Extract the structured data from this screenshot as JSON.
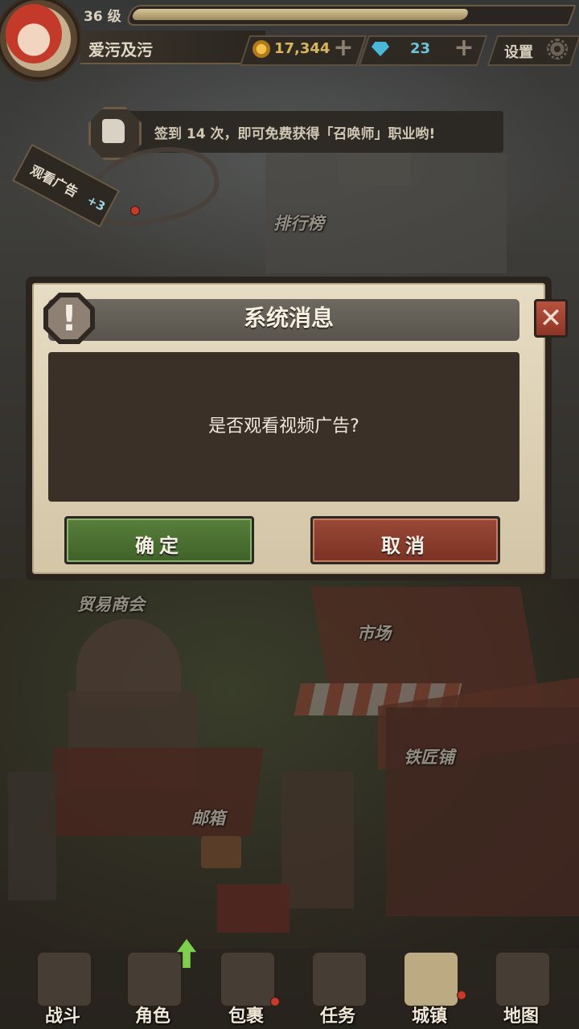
{
  "player": {
    "level": "36 级",
    "name": "爱污及污",
    "xp_progress": 0.77
  },
  "currency": {
    "coins": "17,344",
    "gems": "23",
    "plus": "+"
  },
  "settings_label": "设置",
  "notice": {
    "text": "签到 14 次，即可免费获得「召唤师」职业哟!"
  },
  "ad": {
    "label": "观看广告",
    "reward": "+3"
  },
  "places": {
    "ranking": "排行榜",
    "trade": "贸易商会",
    "market": "市场",
    "blacksmith": "铁匠铺",
    "mailbox": "邮箱"
  },
  "dialog": {
    "title": "系统消息",
    "warn_mark": "!",
    "message": "是否观看视频广告?",
    "confirm": "确定",
    "cancel": "取消",
    "close": "✕"
  },
  "nav": {
    "items": [
      {
        "label": "战斗",
        "icon": "swords-icon"
      },
      {
        "label": "角色",
        "icon": "helmet-icon"
      },
      {
        "label": "包裹",
        "icon": "backpack-icon"
      },
      {
        "label": "任务",
        "icon": "scroll-icon"
      },
      {
        "label": "城镇",
        "icon": "castle-tower-icon"
      },
      {
        "label": "地图",
        "icon": "map-icon"
      }
    ]
  },
  "colors": {
    "confirm": "#4e7434",
    "cancel": "#8b3e2d",
    "badge": "#c63a2a"
  }
}
